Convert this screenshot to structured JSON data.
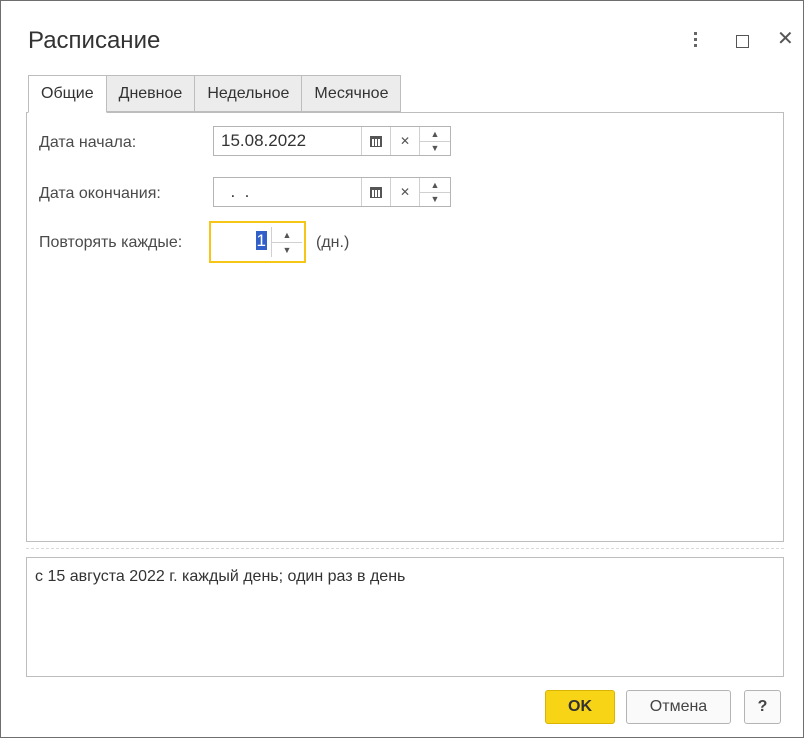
{
  "window": {
    "title": "Расписание",
    "more_icon": "vertical-dots-icon",
    "maximize_icon": "square-icon",
    "close_glyph": "✕"
  },
  "tabs": [
    {
      "label": "Общие",
      "active": true
    },
    {
      "label": "Дневное",
      "active": false
    },
    {
      "label": "Недельное",
      "active": false
    },
    {
      "label": "Месячное",
      "active": false
    }
  ],
  "general": {
    "start_date_label": "Дата начала:",
    "start_date_value": "15.08.2022",
    "end_date_label": "Дата окончания:",
    "end_date_value": "  .  .",
    "repeat_label": "Повторять каждые:",
    "repeat_value": "1",
    "repeat_unit": "(дн.)"
  },
  "summary": "с 15 августа 2022 г. каждый день; один раз в день",
  "buttons": {
    "ok": "OK",
    "cancel": "Отмена",
    "help": "?"
  },
  "colors": {
    "accent": "#f7d416",
    "focus_border": "#f5c518",
    "selection": "#3060c8"
  }
}
